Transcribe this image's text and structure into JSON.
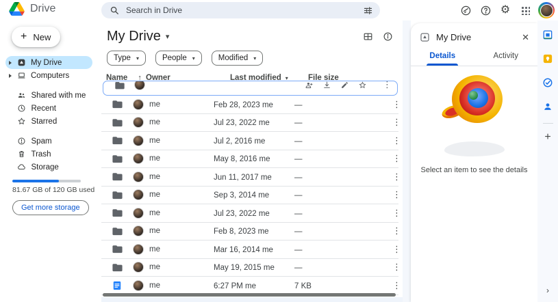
{
  "topbar": {
    "app_name": "Drive",
    "search": {
      "placeholder": "Search in Drive"
    }
  },
  "sidebar": {
    "new_label": "New",
    "items": [
      {
        "label": "My Drive",
        "selected": true
      },
      {
        "label": "Computers",
        "selected": false
      },
      {
        "label": "Shared with me",
        "selected": false
      },
      {
        "label": "Recent",
        "selected": false
      },
      {
        "label": "Starred",
        "selected": false
      },
      {
        "label": "Spam",
        "selected": false
      },
      {
        "label": "Trash",
        "selected": false
      },
      {
        "label": "Storage",
        "selected": false
      }
    ],
    "storage": {
      "percent_used": 68,
      "usage_text": "81.67 GB of 120 GB used",
      "cta_label": "Get more storage"
    }
  },
  "main": {
    "title": "My Drive",
    "filter_chips": [
      {
        "label": "Type"
      },
      {
        "label": "People"
      },
      {
        "label": "Modified"
      }
    ],
    "columns": {
      "name": "Name",
      "owner": "Owner",
      "modified": "Last modified",
      "size": "File size"
    },
    "clipped_row": {
      "kind": "folder",
      "note": "partially scrolled row with selection outline"
    },
    "rows": [
      {
        "kind": "folder",
        "owner": "me",
        "modified": "Feb 28, 2023 me",
        "size": "—"
      },
      {
        "kind": "folder",
        "owner": "me",
        "modified": "Jul 23, 2022 me",
        "size": "—"
      },
      {
        "kind": "folder",
        "owner": "me",
        "modified": "Jul 2, 2016 me",
        "size": "—"
      },
      {
        "kind": "folder",
        "owner": "me",
        "modified": "May 8, 2016 me",
        "size": "—"
      },
      {
        "kind": "folder",
        "owner": "me",
        "modified": "Jun 11, 2017 me",
        "size": "—"
      },
      {
        "kind": "folder",
        "owner": "me",
        "modified": "Sep 3, 2014 me",
        "size": "—"
      },
      {
        "kind": "folder",
        "owner": "me",
        "modified": "Jul 23, 2022 me",
        "size": "—"
      },
      {
        "kind": "folder",
        "owner": "me",
        "modified": "Feb 8, 2023 me",
        "size": "—"
      },
      {
        "kind": "folder",
        "owner": "me",
        "modified": "Mar 16, 2014 me",
        "size": "—"
      },
      {
        "kind": "folder",
        "owner": "me",
        "modified": "May 19, 2015 me",
        "size": "—"
      },
      {
        "kind": "doc",
        "owner": "me",
        "modified": "6:27 PM me",
        "size": "7 KB"
      }
    ]
  },
  "details_panel": {
    "title": "My Drive",
    "tabs": [
      {
        "label": "Details",
        "active": true
      },
      {
        "label": "Activity",
        "active": false
      }
    ],
    "empty_text": "Select an item to see the details"
  },
  "glyphs": {
    "settings": "⚙",
    "more_vert": "⋮",
    "close": "✕",
    "caret_down": "▾",
    "sort_asc": "↑",
    "plus": "+",
    "chevron_right": "›"
  },
  "colors": {
    "accent_blue": "#0b57d0",
    "selected_pill": "#c2e7ff",
    "search_bg": "#e9eef6",
    "storage_fill": "#1a73e8"
  }
}
